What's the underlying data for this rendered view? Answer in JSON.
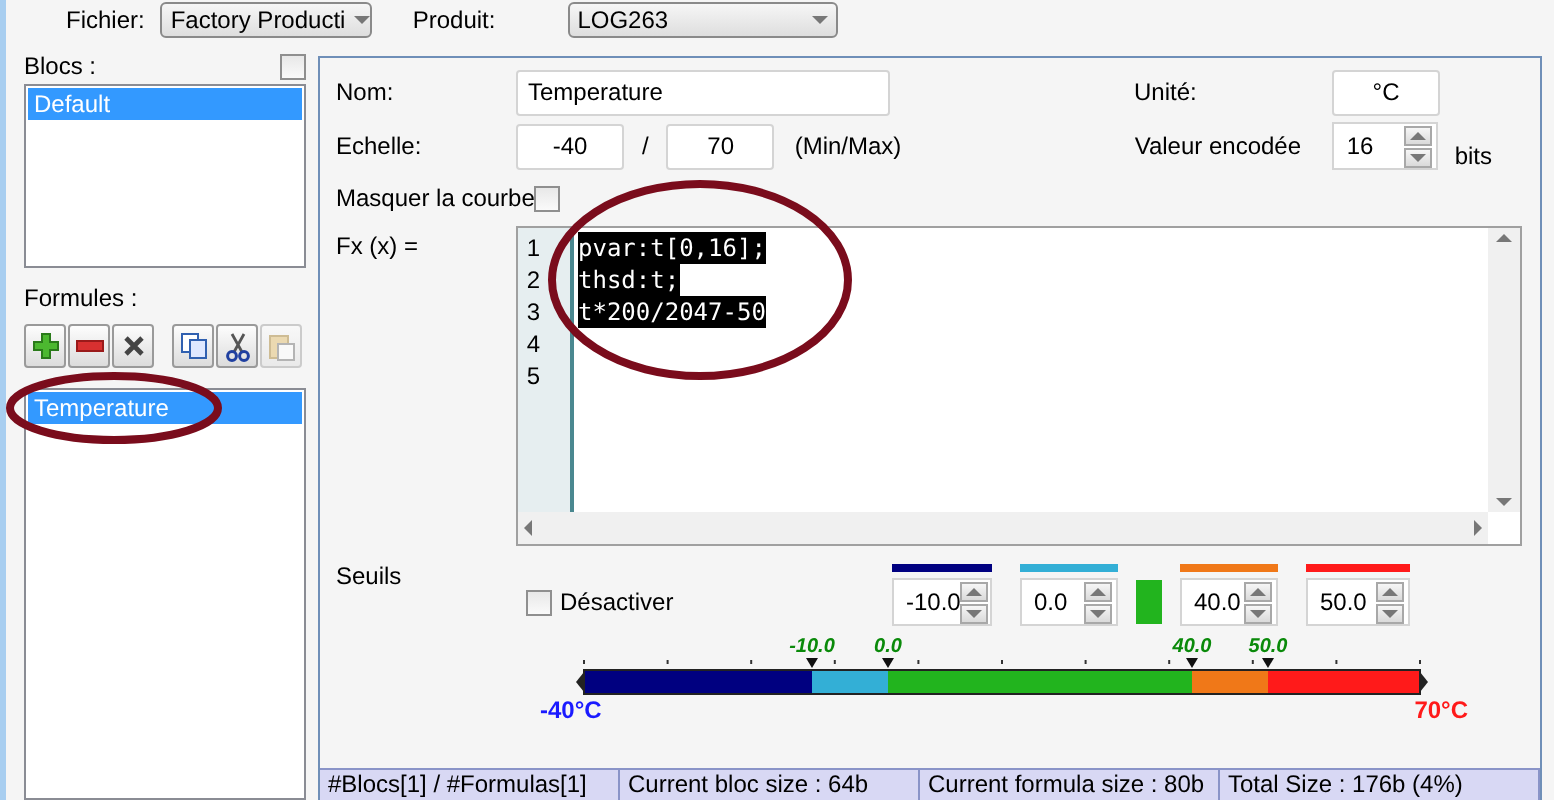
{
  "top_bar": {
    "file_label": "Fichier:",
    "file_value": "Factory Producti",
    "product_label": "Produit:",
    "product_value": "LOG263"
  },
  "blocs": {
    "label": "Blocs :",
    "checked": false,
    "items": [
      {
        "label": "Default",
        "selected": true
      }
    ]
  },
  "formules": {
    "label": "Formules :",
    "toolbar": [
      {
        "kind": "add",
        "disabled": false
      },
      {
        "kind": "remove",
        "disabled": false
      },
      {
        "kind": "delete",
        "disabled": false
      },
      {
        "kind": "copy",
        "disabled": false
      },
      {
        "kind": "cut",
        "disabled": false
      },
      {
        "kind": "paste",
        "disabled": true
      }
    ],
    "items": [
      {
        "label": "Temperature",
        "selected": true
      }
    ]
  },
  "form": {
    "name_label": "Nom:",
    "name_value": "Temperature",
    "unit_label": "Unité:",
    "unit_value": "°C",
    "scale_label": "Echelle:",
    "scale_min": "-40",
    "separator": "/",
    "scale_max": "70",
    "scale_hint": "(Min/Max)",
    "encoded_label": "Valeur encodée",
    "encoded_value": "16",
    "encoded_unit": "bits",
    "hide_curve_label": "Masquer la courbe",
    "hide_curve_checked": false,
    "fx_label": "Fx (x) =",
    "code_lines": [
      {
        "number": "1",
        "text": "pvar:t[0,16];",
        "selected": true
      },
      {
        "number": "2",
        "text": "thsd:t;",
        "selected": true
      },
      {
        "number": "3",
        "text": "t*200/2047-50",
        "selected": true
      },
      {
        "number": "4"
      },
      {
        "number": "5"
      }
    ]
  },
  "thresholds": {
    "label": "Seuils",
    "disable_label": "Désactiver",
    "disable_checked": false,
    "values": [
      {
        "value": "-10.0",
        "color": "#000080"
      },
      {
        "value": "0.0",
        "color": "#33afd6"
      },
      {
        "value": "40.0",
        "color": "#f07818"
      },
      {
        "value": "50.0",
        "color": "#ff1a1a"
      }
    ],
    "middle_zone": {
      "color": "#22b41e"
    },
    "scale": {
      "min_label": "-40°C",
      "max_label": "70°C",
      "markers": [
        "-10.0",
        "0.0",
        "40.0",
        "50.0"
      ]
    }
  },
  "annotations": [
    {
      "kind": "ellipse",
      "color": "#7a0c1c"
    },
    {
      "kind": "ellipse",
      "color": "#7a0c1c"
    }
  ],
  "status_bar": [
    {
      "text": "#Blocs[1] / #Formulas[1]"
    },
    {
      "text": "Current bloc size : 64b"
    },
    {
      "text": "Current formula size : 80b"
    },
    {
      "text": "Total Size : 176b (4%)"
    }
  ]
}
